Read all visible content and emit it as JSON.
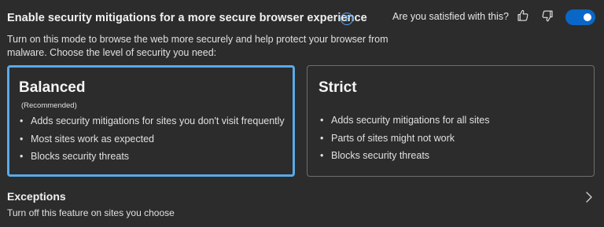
{
  "header": {
    "title": "Enable security mitigations for a more secure browser experience",
    "help_icon": "?",
    "feedback_question": "Are you satisfied with this?",
    "toggle_on": true
  },
  "description": "Turn on this mode to browse the web more securely and help protect your browser from malware. Choose the level of security you need:",
  "modes": [
    {
      "title": "Balanced",
      "subtitle": "(Recommended)",
      "selected": true,
      "bullets": [
        "Adds security mitigations for sites you don't visit frequently",
        "Most sites work as expected",
        "Blocks security threats"
      ]
    },
    {
      "title": "Strict",
      "selected": false,
      "bullets": [
        "Adds security mitigations for all sites",
        "Parts of sites might not work",
        "Blocks security threats"
      ]
    }
  ],
  "exceptions": {
    "title": "Exceptions",
    "subtitle": "Turn off this feature on sites you choose"
  },
  "bullet_char": "•",
  "colors": {
    "background": "#2c2c2c",
    "accent": "#5aaae8",
    "toggle": "#0a67c7",
    "help": "#5aa5f5"
  }
}
